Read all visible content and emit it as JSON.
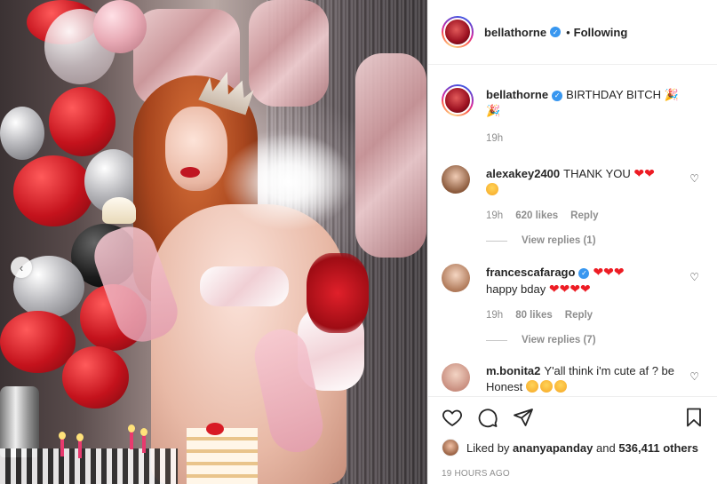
{
  "header": {
    "username": "bellathorne",
    "separator": "•",
    "follow_status": "Following"
  },
  "caption": {
    "username": "bellathorne",
    "text": "BIRTHDAY BITCH",
    "emojis": "🎉🎉",
    "time": "19h"
  },
  "comments": [
    {
      "username": "alexakey2400",
      "text": "THANK YOU",
      "hearts": "❤❤",
      "time": "19h",
      "likes": "620 likes",
      "reply_label": "Reply",
      "view_replies": "View replies (1)"
    },
    {
      "username": "francescafarago",
      "text": "happy bday",
      "hearts_inline": "❤❤❤",
      "hearts_after": "❤❤❤❤",
      "time": "19h",
      "likes": "80 likes",
      "reply_label": "Reply",
      "view_replies": "View replies (7)"
    },
    {
      "username": "m.bonita2",
      "text": "Y'all think i'm cute af ? be Honest",
      "time": "",
      "likes": ""
    }
  ],
  "actions": {
    "liked_by_prefix": "Liked by",
    "liked_by_user": "ananyapanday",
    "liked_by_and": "and",
    "liked_by_others": "536,411 others",
    "timestamp": "19 HOURS AGO"
  },
  "carousel": {
    "prev_label": "‹"
  },
  "colors": {
    "verified_blue": "#3897f0",
    "heart_red": "#ed1c24",
    "text_primary": "#262626",
    "text_secondary": "#8e8e8e"
  },
  "icons": [
    "heart-icon",
    "comment-icon",
    "share-icon",
    "bookmark-icon",
    "verified-icon",
    "chevron-left-icon"
  ]
}
